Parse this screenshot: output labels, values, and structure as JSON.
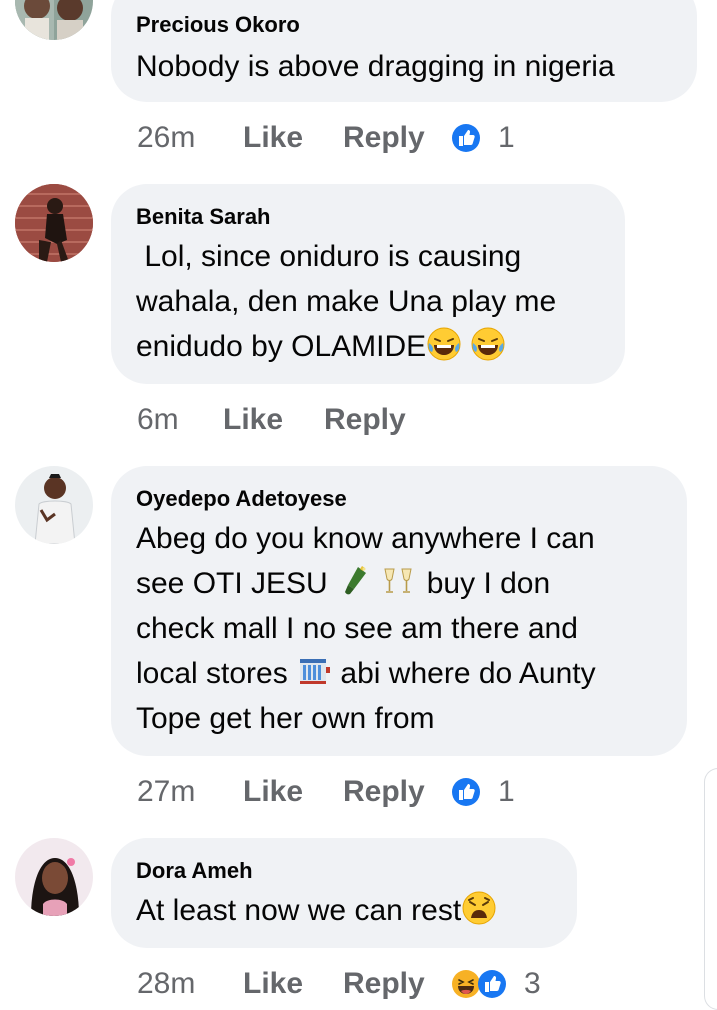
{
  "comments": [
    {
      "author": "Precious Okoro",
      "lines": [
        "Nobody is above dragging in nigeria"
      ],
      "time": "26m",
      "like_label": "Like",
      "reply_label": "Reply",
      "reaction_count": "1",
      "reactions": [
        "like"
      ]
    },
    {
      "author": "Benita Sarah",
      "lines": [
        " Lol, since oniduro is causing",
        "wahala, den make Una play me",
        "enidudo by OLAMIDE"
      ],
      "time": "6m",
      "like_label": "Like",
      "reply_label": "Reply",
      "reaction_count": "",
      "reactions": []
    },
    {
      "author": "Oyedepo Adetoyese",
      "lines": [
        "Abeg do you know anywhere I can",
        "see OTI JESU",
        "buy I don",
        "check mall I no see am there and",
        "local stores",
        "abi where do Aunty",
        "Tope get her own from"
      ],
      "time": "27m",
      "like_label": "Like",
      "reply_label": "Reply",
      "reaction_count": "1",
      "reactions": [
        "like"
      ]
    },
    {
      "author": "Dora Ameh",
      "lines": [
        "At least now we can rest"
      ],
      "time": "28m",
      "like_label": "Like",
      "reply_label": "Reply",
      "reaction_count": "3",
      "reactions": [
        "haha",
        "like"
      ]
    }
  ],
  "colors": {
    "bubble": "#f0f2f5",
    "meta_text": "#65676b",
    "like_blue": "#1877f2"
  },
  "icons": [
    "laughing-tears-emoji",
    "champagne-emoji",
    "clinking-glasses-emoji",
    "department-store-emoji",
    "weary-face-emoji",
    "like-reaction-icon",
    "haha-reaction-icon"
  ]
}
